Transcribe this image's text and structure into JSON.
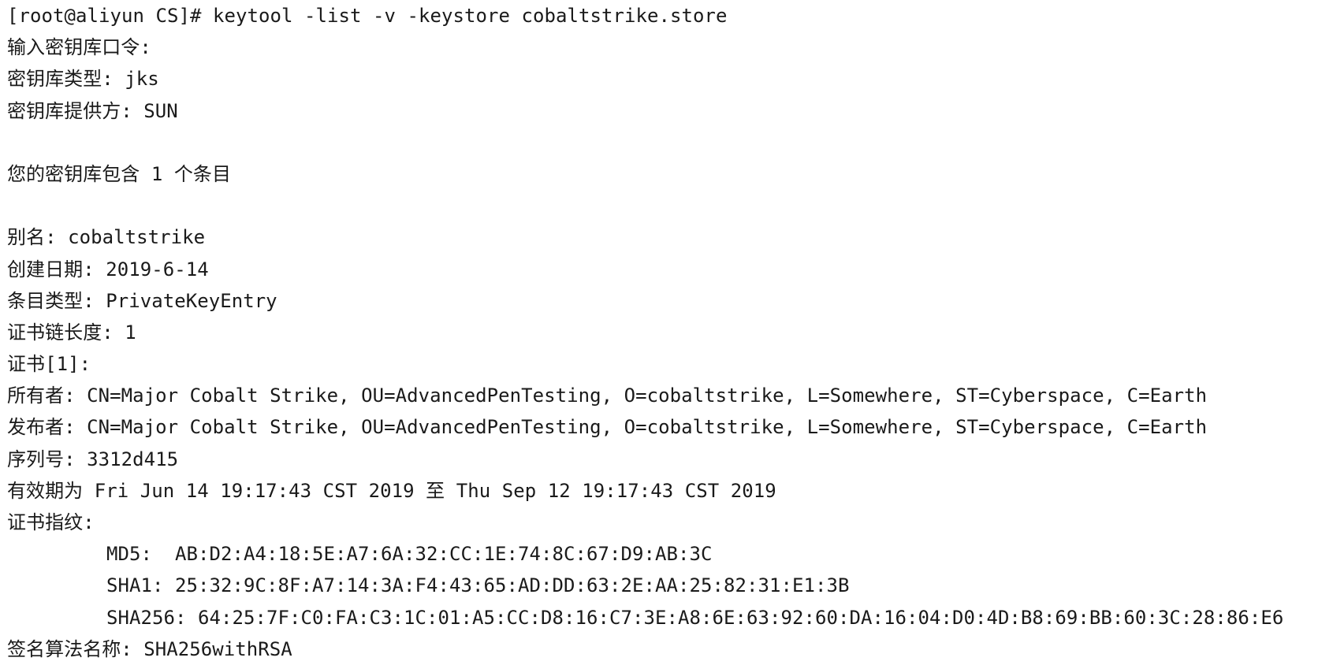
{
  "terminal": {
    "lines": [
      "[root@aliyun CS]# keytool -list -v -keystore cobaltstrike.store",
      "输入密钥库口令:",
      "密钥库类型: jks",
      "密钥库提供方: SUN",
      "",
      "您的密钥库包含 1 个条目",
      "",
      "别名: cobaltstrike",
      "创建日期: 2019-6-14",
      "条目类型: PrivateKeyEntry",
      "证书链长度: 1",
      "证书[1]:",
      "所有者: CN=Major Cobalt Strike, OU=AdvancedPenTesting, O=cobaltstrike, L=Somewhere, ST=Cyberspace, C=Earth",
      "发布者: CN=Major Cobalt Strike, OU=AdvancedPenTesting, O=cobaltstrike, L=Somewhere, ST=Cyberspace, C=Earth",
      "序列号: 3312d415",
      "有效期为 Fri Jun 14 19:17:43 CST 2019 至 Thu Sep 12 19:17:43 CST 2019",
      "证书指纹:",
      "MD5:  AB:D2:A4:18:5E:A7:6A:32:CC:1E:74:8C:67:D9:AB:3C",
      "SHA1: 25:32:9C:8F:A7:14:3A:F4:43:65:AD:DD:63:2E:AA:25:82:31:E1:3B",
      "SHA256: 64:25:7F:C0:FA:C3:1C:01:A5:CC:D8:16:C7:3E:A8:6E:63:92:60:DA:16:04:D0:4D:B8:69:BB:60:3C:28:86:E6",
      "签名算法名称: SHA256withRSA"
    ]
  }
}
